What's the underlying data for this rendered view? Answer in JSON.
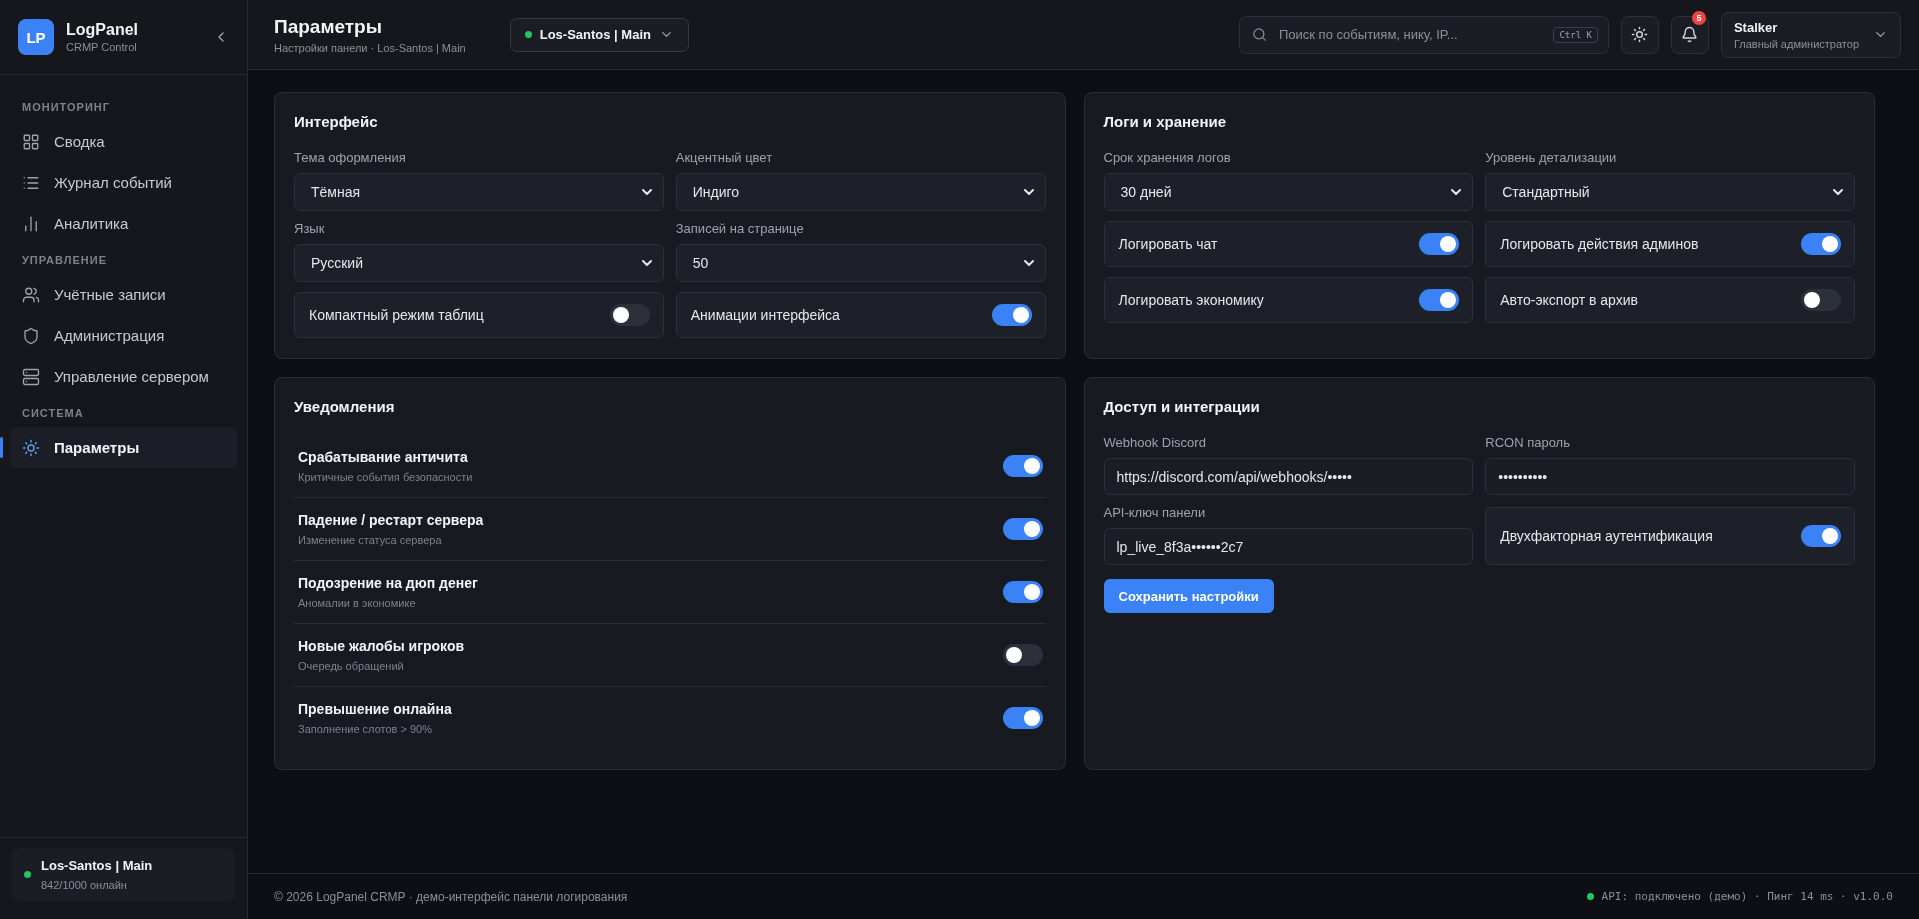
{
  "brand": {
    "logo": "LP",
    "name": "LogPanel",
    "tagline": "CRMP Control"
  },
  "sidebar": {
    "groups": [
      {
        "title": "МОНИТОРИНГ",
        "items": [
          {
            "label": "Сводка",
            "selected": false
          },
          {
            "label": "Журнал событий",
            "selected": false
          },
          {
            "label": "Аналитика",
            "selected": false
          }
        ]
      },
      {
        "title": "УПРАВЛЕНИЕ",
        "items": [
          {
            "label": "Учётные записи",
            "selected": false
          },
          {
            "label": "Администрация",
            "selected": false
          },
          {
            "label": "Управление сервером",
            "selected": false
          }
        ]
      },
      {
        "title": "СИСТЕМА",
        "items": [
          {
            "label": "Параметры",
            "selected": true
          }
        ]
      }
    ],
    "server": {
      "name": "Los-Santos | Main",
      "online": "842/1000 онлайн",
      "color": "#22c55e"
    }
  },
  "header": {
    "title": "Параметры",
    "subtitle": "Настройки панели · Los-Santos | Main",
    "server": {
      "label": "Los-Santos | Main",
      "color": "#22c55e"
    },
    "search": {
      "placeholder": "Поиск по событиям, нику, IP...",
      "shortcut": "Ctrl K"
    },
    "notifications": "5",
    "user": {
      "name": "Stalker",
      "role": "Главный администратор"
    }
  },
  "cards": [
    {
      "title": "Интерфейс",
      "fields": [
        {
          "kind": "select",
          "label": "Тема оформления",
          "value": "Тёмная"
        },
        {
          "kind": "select",
          "label": "Акцентный цвет",
          "value": "Индиго"
        },
        {
          "kind": "select",
          "label": "Язык",
          "value": "Русский"
        },
        {
          "kind": "select",
          "label": "Записей на странице",
          "value": "50"
        },
        {
          "kind": "toggle",
          "label": "Компактный режим таблиц",
          "on": false
        },
        {
          "kind": "toggle",
          "label": "Анимации интерфейса",
          "on": true
        }
      ]
    },
    {
      "title": "Логи и хранение",
      "fields": [
        {
          "kind": "select",
          "label": "Срок хранения логов",
          "value": "30 дней"
        },
        {
          "kind": "select",
          "label": "Уровень детализации",
          "value": "Стандартный"
        },
        {
          "kind": "toggle",
          "label": "Логировать чат",
          "on": true
        },
        {
          "kind": "toggle",
          "label": "Логировать действия админов",
          "on": true
        },
        {
          "kind": "toggle",
          "label": "Логировать экономику",
          "on": true
        },
        {
          "kind": "toggle",
          "label": "Авто-экспорт в архив",
          "on": false
        }
      ]
    },
    {
      "title": "Уведомления",
      "notifications": [
        {
          "title": "Срабатывание античита",
          "description": "Критичные события безопасности",
          "on": true
        },
        {
          "title": "Падение / рестарт сервера",
          "description": "Изменение статуса сервера",
          "on": true
        },
        {
          "title": "Подозрение на дюп денег",
          "description": "Аномалии в экономике",
          "on": true
        },
        {
          "title": "Новые жалобы игроков",
          "description": "Очередь обращений",
          "on": false
        },
        {
          "title": "Превышение онлайна",
          "description": "Заполнение слотов > 90%",
          "on": true
        }
      ]
    },
    {
      "title": "Доступ и интеграции",
      "fields": [
        {
          "kind": "input",
          "label": "Webhook Discord",
          "value": "https://discord.com/api/webhooks/•••••"
        },
        {
          "kind": "input",
          "label": "RCON пароль",
          "value": "••••••••••"
        },
        {
          "kind": "input",
          "label": "API-ключ панели",
          "value": "lp_live_8f3a••••••2c7"
        },
        {
          "kind": "toggle",
          "label": "Двухфакторная аутентификация",
          "on": true
        }
      ],
      "button": "Сохранить настройки"
    }
  ],
  "footer": {
    "left": "© 2026 LogPanel CRMP · демо-интерфейс панели логирования",
    "right": "API: подключено (демо) · Пинг 14 ms · v1.0.0",
    "color": "#22c55e"
  }
}
